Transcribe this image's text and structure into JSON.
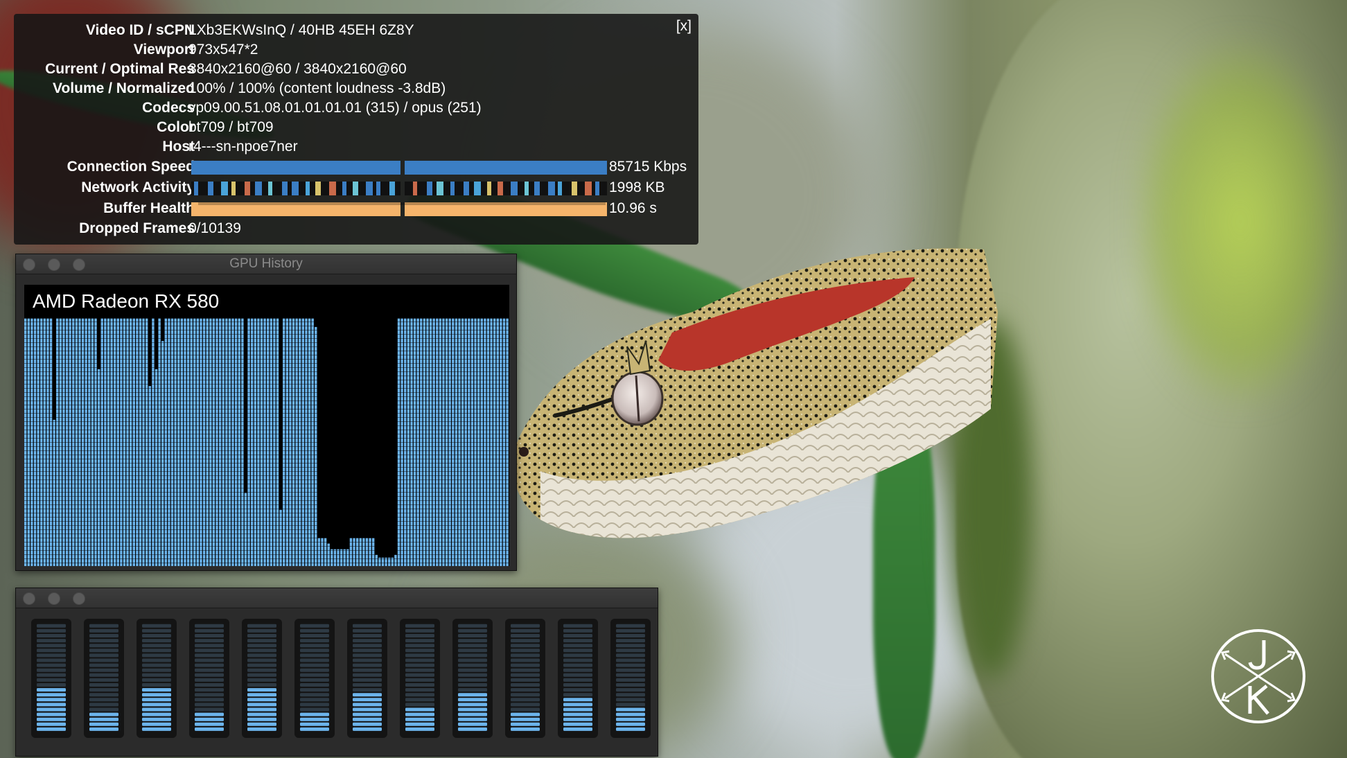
{
  "stats": {
    "close_label": "[x]",
    "rows": [
      {
        "label": "Video ID / sCPN",
        "value": "LXb3EKWsInQ / 40HB 45EH 6Z8Y"
      },
      {
        "label": "Viewport",
        "value": "973x547*2"
      },
      {
        "label": "Current / Optimal Res",
        "value": "3840x2160@60 / 3840x2160@60"
      },
      {
        "label": "Volume / Normalized",
        "value": "100% / 100% (content loudness -3.8dB)"
      },
      {
        "label": "Codecs",
        "value": "vp09.00.51.08.01.01.01.01 (315) / opus (251)"
      },
      {
        "label": "Color",
        "value": "bt709 / bt709"
      },
      {
        "label": "Host",
        "value": "r4---sn-npoe7ner"
      }
    ],
    "connection": {
      "label": "Connection Speed",
      "value": "85715 Kbps",
      "color": "#3b7ec4"
    },
    "network": {
      "label": "Network Activity",
      "value": "1998 KB"
    },
    "buffer": {
      "label": "Buffer Health",
      "value": "10.96 s",
      "color": "#f5b46b"
    },
    "dropped": {
      "label": "Dropped Frames",
      "value": "0/10139"
    }
  },
  "gpu_window": {
    "title": "GPU History",
    "gpu_name": "AMD Radeon RX 580",
    "bar_color": "#6cb4ec",
    "usage_fraction": [
      0.88,
      0.88,
      0.88,
      0.88,
      0.88,
      0.88,
      0.88,
      0.88,
      0.88,
      0.52,
      0.88,
      0.88,
      0.88,
      0.88,
      0.88,
      0.88,
      0.88,
      0.88,
      0.88,
      0.88,
      0.88,
      0.88,
      0.88,
      0.7,
      0.88,
      0.88,
      0.88,
      0.88,
      0.88,
      0.88,
      0.88,
      0.88,
      0.88,
      0.88,
      0.88,
      0.88,
      0.88,
      0.88,
      0.88,
      0.64,
      0.88,
      0.7,
      0.88,
      0.8,
      0.88,
      0.88,
      0.88,
      0.88,
      0.88,
      0.88,
      0.88,
      0.88,
      0.88,
      0.88,
      0.88,
      0.88,
      0.88,
      0.88,
      0.88,
      0.88,
      0.88,
      0.88,
      0.88,
      0.88,
      0.88,
      0.88,
      0.88,
      0.88,
      0.88,
      0.26,
      0.88,
      0.88,
      0.88,
      0.88,
      0.88,
      0.88,
      0.88,
      0.88,
      0.88,
      0.88,
      0.2,
      0.88,
      0.88,
      0.88,
      0.88,
      0.88,
      0.88,
      0.88,
      0.88,
      0.88,
      0.88,
      0.85,
      0.1,
      0.1,
      0.1,
      0.08,
      0.06,
      0.06,
      0.06,
      0.06,
      0.06,
      0.06,
      0.1,
      0.1,
      0.1,
      0.1,
      0.1,
      0.1,
      0.1,
      0.1,
      0.04,
      0.03,
      0.03,
      0.03,
      0.03,
      0.03,
      0.04,
      0.88,
      0.88,
      0.88,
      0.88,
      0.88,
      0.88,
      0.88,
      0.88,
      0.88,
      0.88,
      0.88,
      0.88,
      0.88,
      0.88,
      0.88,
      0.88,
      0.88,
      0.88,
      0.88,
      0.88,
      0.88,
      0.88,
      0.88,
      0.88,
      0.88,
      0.88,
      0.88,
      0.88,
      0.88,
      0.88,
      0.88,
      0.88,
      0.88,
      0.88,
      0.88
    ]
  },
  "meter_window": {
    "active_color": "#6cb4ec",
    "levels": [
      0.42,
      0.18,
      0.42,
      0.18,
      0.42,
      0.18,
      0.38,
      0.22,
      0.38,
      0.18,
      0.34,
      0.22
    ]
  }
}
